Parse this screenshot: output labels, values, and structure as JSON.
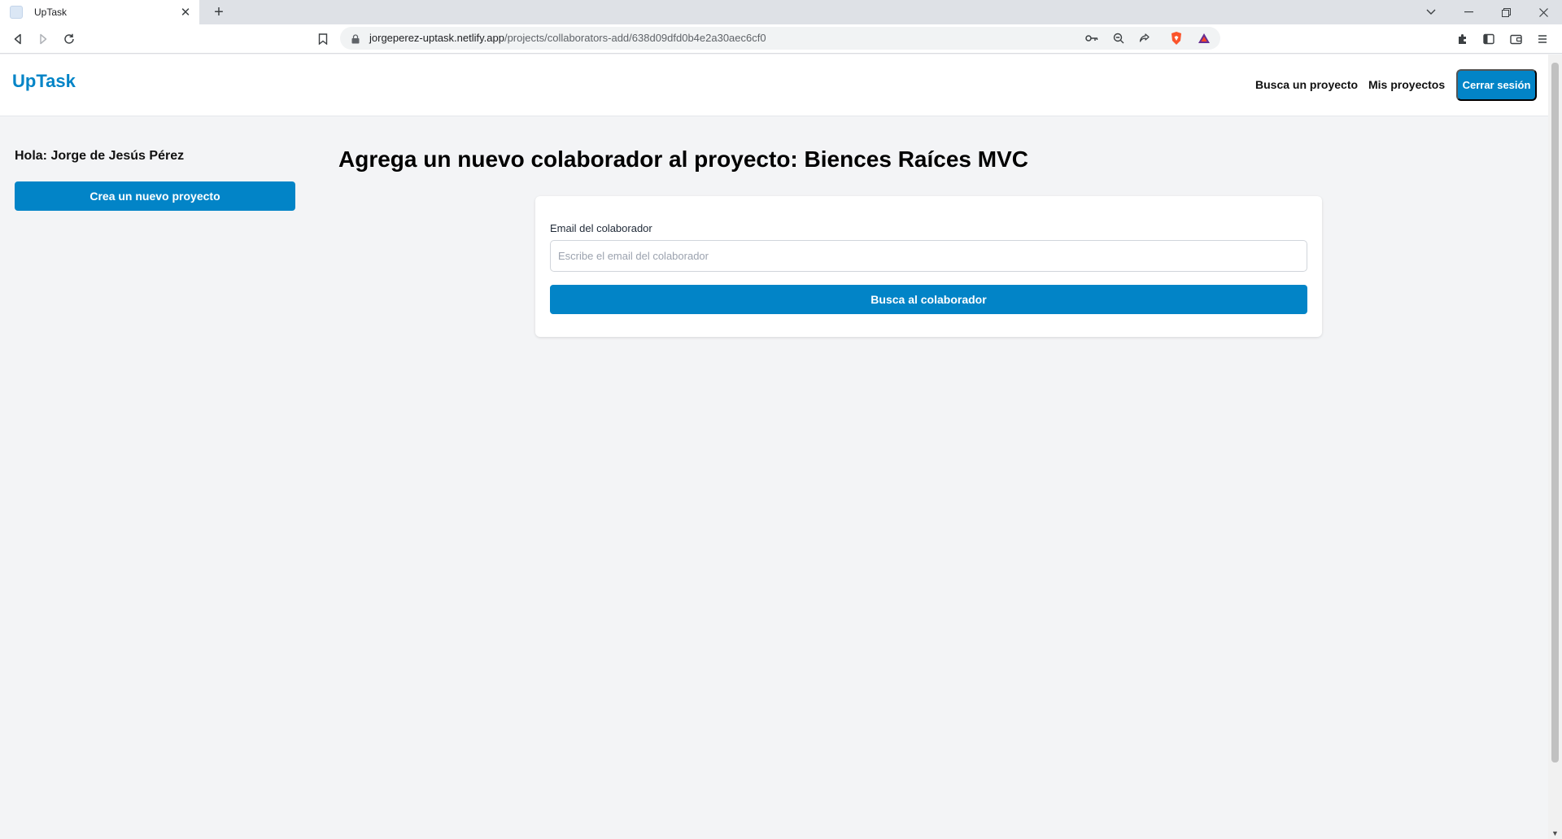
{
  "browser": {
    "tab_title": "UpTask",
    "tab_close": "✕",
    "new_tab": "+",
    "url_host": "jorgeperez-uptask.netlify.app",
    "url_path": "/projects/collaborators-add/638d09dfd0b4e2a30aec6cf0"
  },
  "header": {
    "logo": "UpTask",
    "nav": [
      {
        "label": "Busca un proyecto"
      },
      {
        "label": "Mis proyectos"
      }
    ],
    "logout_label": "Cerrar sesión"
  },
  "sidebar": {
    "greeting": "Hola: Jorge de Jesús Pérez",
    "new_project_label": "Crea un nuevo proyecto"
  },
  "main": {
    "title": "Agrega un nuevo colaborador al proyecto: Biences Raíces MVC",
    "form": {
      "email_label": "Email del colaborador",
      "email_placeholder": "Escribe el email del colaborador",
      "email_value": "",
      "submit_label": "Busca al colaborador"
    }
  },
  "colors": {
    "accent": "#0284c7",
    "background": "#f3f4f6"
  }
}
